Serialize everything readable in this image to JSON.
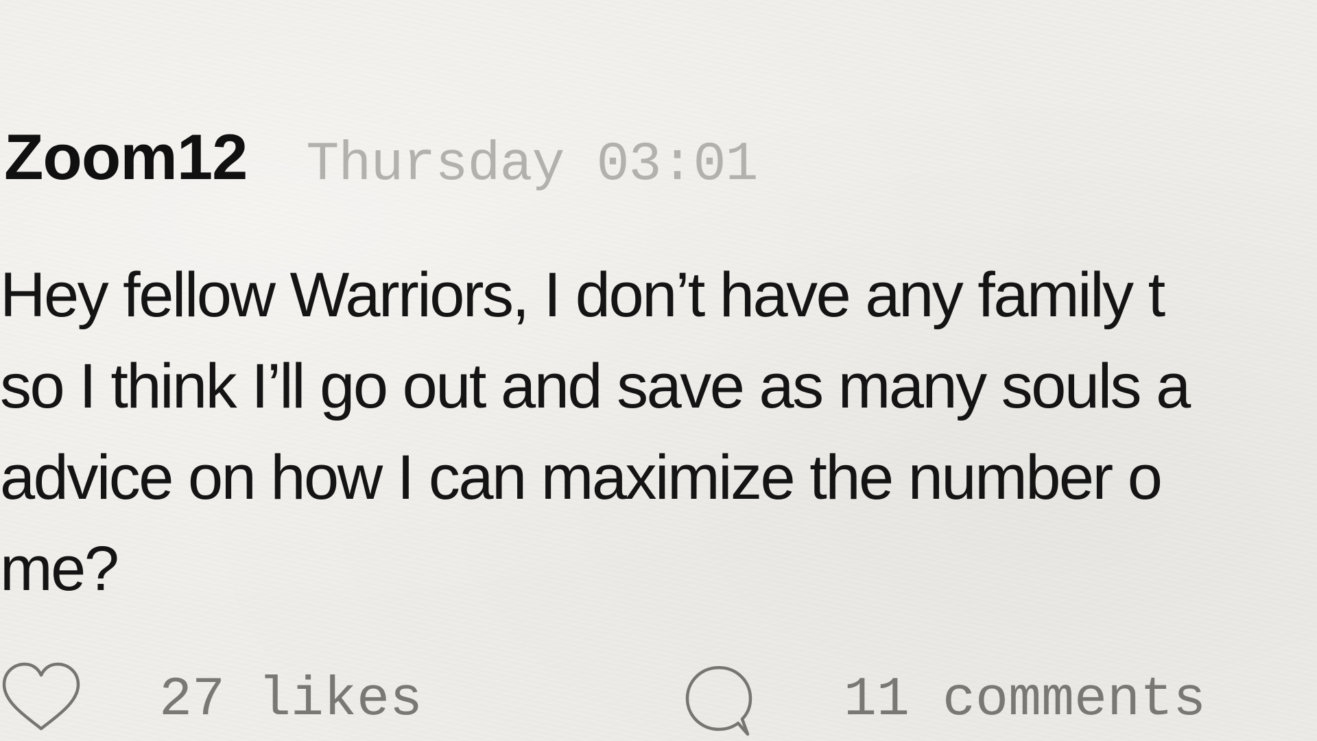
{
  "post": {
    "username": "Zoom12",
    "timestamp": "Thursday 03:01",
    "body_lines": [
      "Hey fellow Warriors, I don’t have any family t",
      "so I think I’ll go out and save as many souls a",
      "advice on how I can maximize the number o",
      "me?"
    ],
    "likes_label": "27 likes",
    "comments_label": "11 comments",
    "icons": {
      "like": "heart-icon",
      "comment": "speech-bubble-icon"
    },
    "colors": {
      "background": "#efede9",
      "username": "#101010",
      "timestamp": "#b3b1ad",
      "body_text": "#141414",
      "footer_text": "#7a7875",
      "icon_stroke": "#777572"
    }
  }
}
